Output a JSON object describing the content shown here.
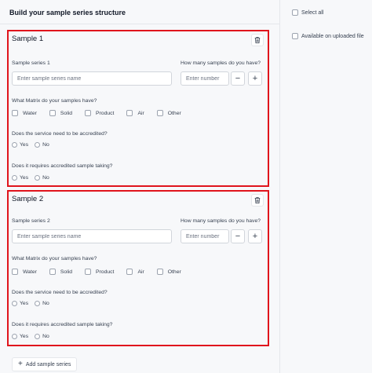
{
  "header": {
    "title": "Build your sample series structure"
  },
  "sidebar": {
    "options": [
      {
        "label": "Select all"
      },
      {
        "label": "Available on uploaded file"
      }
    ]
  },
  "samples": [
    {
      "title": "Sample 1",
      "series_label": "Sample series 1",
      "series_placeholder": "Enter sample series name",
      "count_label": "How many samples do you have?",
      "count_placeholder": "Enter number",
      "minus": "−",
      "plus": "+",
      "matrix_question": "What Matrix do your samples have?",
      "matrix_options": [
        "Water",
        "Solid",
        "Product",
        "Air",
        "Other"
      ],
      "accredited_question": "Does the service need to be accredited?",
      "taking_question": "Does it requires accredited sample taking?",
      "yes": "Yes",
      "no": "No"
    },
    {
      "title": "Sample 2",
      "series_label": "Sample series 2",
      "series_placeholder": "Enter sample series name",
      "count_label": "How many samples do you have?",
      "count_placeholder": "Enter number",
      "minus": "−",
      "plus": "+",
      "matrix_question": "What Matrix do your samples have?",
      "matrix_options": [
        "Water",
        "Solid",
        "Product",
        "Air",
        "Other"
      ],
      "accredited_question": "Does the service need to be accredited?",
      "taking_question": "Does it requires accredited sample taking?",
      "yes": "Yes",
      "no": "No"
    }
  ],
  "footer": {
    "add_label": "Add sample series"
  },
  "colors": {
    "highlight": "#e0141c",
    "background": "#f7f8fa"
  },
  "icons": {
    "delete": "trash-icon",
    "add": "plus-icon"
  }
}
